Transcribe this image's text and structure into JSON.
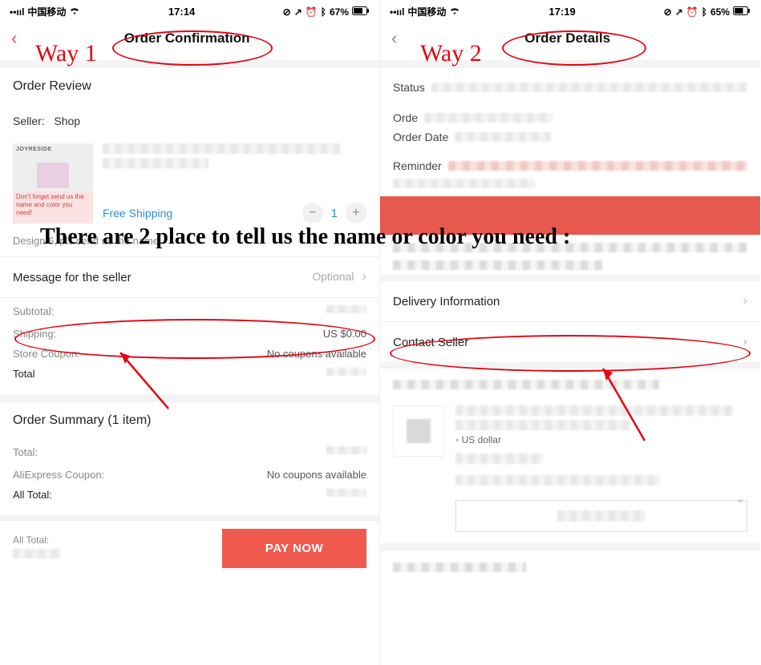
{
  "annotation": {
    "way1": "Way 1",
    "way2": "Way 2",
    "overlay": "There are 2 place to tell us the name or color you need :"
  },
  "left": {
    "status": {
      "carrier": "中国移动",
      "time": "17:14",
      "battery": "67%"
    },
    "nav_title": "Order Confirmation",
    "review_title": "Order Review",
    "seller_label": "Seller:",
    "seller_name": "Shop",
    "thumb_brand": "JOYRESIDE",
    "thumb_warning": "Don't forget send us the name and color you need!",
    "free_shipping": "Free Shipping",
    "qty": "1",
    "variant_note": "Design 6, pls send us the name",
    "msg_row": {
      "label": "Message for the seller",
      "hint": "Optional"
    },
    "subtotal_k": "Subtotal:",
    "shipping_k": "Shipping:",
    "shipping_v": "US $0.00",
    "coupon_k": "Store Coupon:",
    "coupon_v": "No coupons available",
    "total_k": "Total",
    "summary_title": "Order Summary (1 item)",
    "sum_total_k": "Total:",
    "sum_ali_k": "AliExpress Coupon:",
    "sum_ali_v": "No coupons available",
    "sum_all_k": "All Total:",
    "paybar_all": "All Total:",
    "pay_btn": "PAY NOW"
  },
  "right": {
    "status": {
      "carrier": "中国移动",
      "time": "17:19",
      "battery": "65%"
    },
    "nav_title": "Order Details",
    "status_label": "Status",
    "order_label": "Orde",
    "orderdate_label": "Order Date",
    "reminder_label": "Reminder",
    "delivery_label": "Delivery Information",
    "contact_label": "Contact Seller",
    "currency_note": "US dollar"
  }
}
